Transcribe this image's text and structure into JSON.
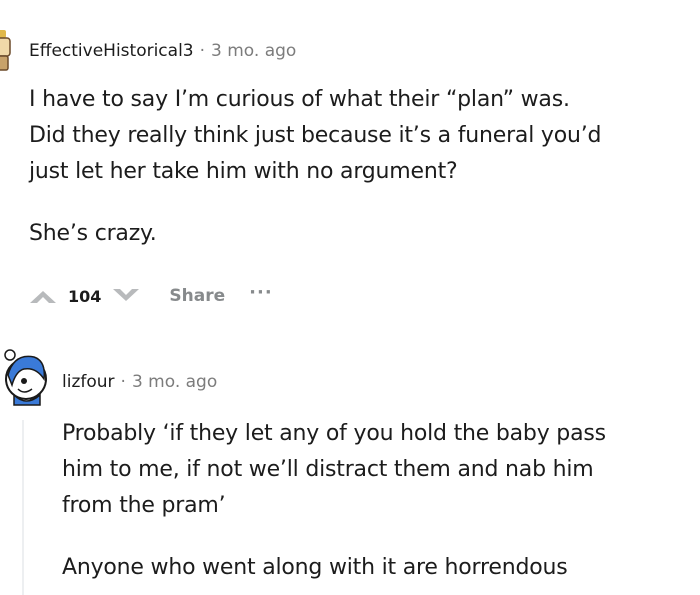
{
  "comments": [
    {
      "author": "EffectiveHistorical3",
      "separator": "·",
      "time": "3 mo. ago",
      "paragraphs": [
        "I have to say I’m curious of what their “plan” was.",
        "Did they really think just because it’s a funeral you’d",
        "just let her take him with no argument?",
        "She’s crazy."
      ],
      "score": "104",
      "share_label": "Share",
      "more_label": "···",
      "upvote_icon": "upvote-arrow-icon",
      "downvote_icon": "downvote-arrow-icon"
    },
    {
      "author": "lizfour",
      "separator": "·",
      "time": "3 mo. ago",
      "paragraphs": [
        "Probably ‘if they let any of you hold the baby pass",
        "him to me, if not we’ll distract them and nab him",
        "from the pram’",
        "Anyone who went along with it are horrendous"
      ]
    }
  ],
  "colors": {
    "text": "#1c1c1c",
    "meta": "#7c7c7c",
    "action": "#878a8c",
    "thread_line": "#edeff1"
  }
}
